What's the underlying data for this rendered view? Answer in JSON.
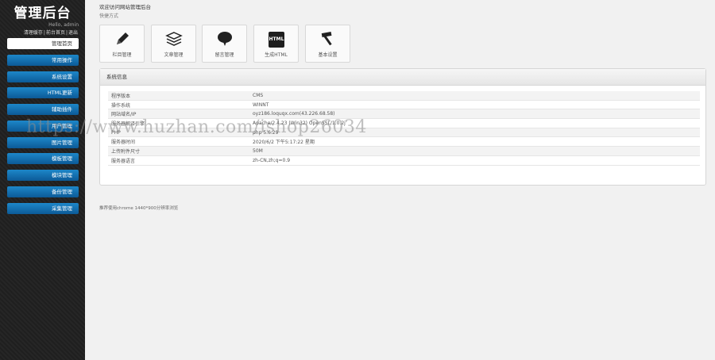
{
  "sidebar": {
    "title": "管理后台",
    "hello": "Hello, admin",
    "links": [
      "清理缓存",
      "前台首页",
      "退出"
    ],
    "items": [
      {
        "label": "管理首页",
        "active": true
      },
      {
        "label": "常用操作"
      },
      {
        "label": "系统设置"
      },
      {
        "label": "HTML更新"
      },
      {
        "label": "辅助插件"
      },
      {
        "label": "用户管理"
      },
      {
        "label": "图片管理"
      },
      {
        "label": "模板管理"
      },
      {
        "label": "模块管理"
      },
      {
        "label": "备份管理"
      },
      {
        "label": "采集管理"
      }
    ]
  },
  "main": {
    "welcome": "欢迎访问网站管理后台",
    "shortcut_title": "快捷方式",
    "shortcuts": [
      {
        "label": "栏目管理",
        "icon": "pencil-icon"
      },
      {
        "label": "文章管理",
        "icon": "stack-icon"
      },
      {
        "label": "留言管理",
        "icon": "chat-bubble-icon"
      },
      {
        "label": "生成HTML",
        "icon": "html-icon",
        "icon_text": "HTML"
      },
      {
        "label": "基本设置",
        "icon": "hammer-icon"
      }
    ],
    "panel_title": "系统信息",
    "info_rows": [
      {
        "key": "程序版本",
        "value": "CMS"
      },
      {
        "key": "操作系统",
        "value": "WINNT"
      },
      {
        "key": "网站域名/IP",
        "value": "oyz186.loquqx.com(43.226.68.58)"
      },
      {
        "key": "服务器解译引擎",
        "value": "Apache/2.4.23 (Win32) OpenSSL/1.0.2j"
      },
      {
        "key": "PHP",
        "value": "php 5.6.29"
      },
      {
        "key": "服务器时间",
        "value": "2020/6/2 下午5:17:22 星期"
      },
      {
        "key": "上传附件尺寸",
        "value": "50M"
      },
      {
        "key": "服务器语言",
        "value": "zh-CN,zh;q=0.9"
      }
    ],
    "footer": "推荐使用chrome 1440*900分辨率浏览"
  },
  "watermark": "https://www.huzhan.com/ishop26034"
}
